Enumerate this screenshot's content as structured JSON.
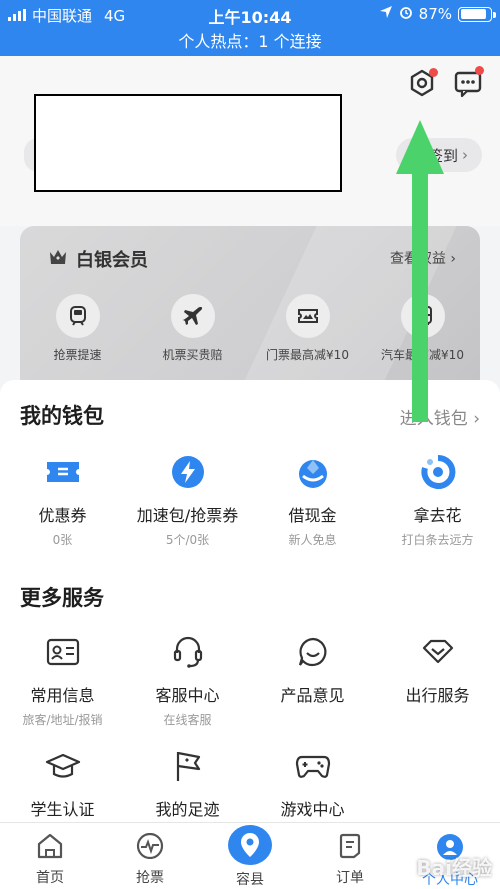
{
  "status_bar": {
    "carrier": "中国联通",
    "network": "4G",
    "time": "上午10:44",
    "battery": "87%",
    "battery_level": 0.87,
    "hotspot": "个人热点：1 个连接"
  },
  "header": {
    "checkin_label": "签到",
    "settings_icon": "settings-hexagon-icon",
    "message_icon": "message-dots-icon"
  },
  "member": {
    "title": "白银会员",
    "more": "查看权益 ›",
    "items": [
      {
        "label": "抢票提速",
        "icon": "train-icon"
      },
      {
        "label": "机票买贵赔",
        "icon": "plane-icon"
      },
      {
        "label": "门票最高减¥10",
        "icon": "ticket-icon"
      },
      {
        "label": "汽车最高减¥10",
        "icon": "bus-icon"
      }
    ]
  },
  "wallet": {
    "title": "我的钱包",
    "link": "进入钱包 ›",
    "items": [
      {
        "label": "优惠券",
        "sub": "0张",
        "icon": "coupon-icon"
      },
      {
        "label": "加速包/抢票券",
        "sub": "5个/0张",
        "icon": "lightning-icon"
      },
      {
        "label": "借现金",
        "sub": "新人免息",
        "icon": "cash-icon"
      },
      {
        "label": "拿去花",
        "sub": "打白条去远方",
        "icon": "pay-later-icon"
      }
    ]
  },
  "services": {
    "title": "更多服务",
    "row1": [
      {
        "label": "常用信息",
        "sub": "旅客/地址/报销",
        "icon": "id-card-icon"
      },
      {
        "label": "客服中心",
        "sub": "在线客服",
        "icon": "headset-icon"
      },
      {
        "label": "产品意见",
        "sub": "",
        "icon": "feedback-icon"
      },
      {
        "label": "出行服务",
        "sub": "",
        "icon": "travel-service-icon"
      }
    ],
    "row2": [
      {
        "label": "学生认证",
        "icon": "graduation-cap-icon"
      },
      {
        "label": "我的足迹",
        "icon": "flag-icon"
      },
      {
        "label": "游戏中心",
        "icon": "gamepad-icon"
      }
    ]
  },
  "tabs": [
    {
      "label": "首页",
      "icon": "home-icon"
    },
    {
      "label": "抢票",
      "icon": "pulse-icon"
    },
    {
      "label": "容县",
      "icon": "location-pin-icon"
    },
    {
      "label": "订单",
      "icon": "order-icon"
    },
    {
      "label": "个人中心",
      "icon": "profile-icon"
    }
  ],
  "watermark": "Bai经验",
  "colors": {
    "brand": "#2f86ee",
    "arrow": "#4cd26b",
    "badge": "#f04b4b"
  }
}
